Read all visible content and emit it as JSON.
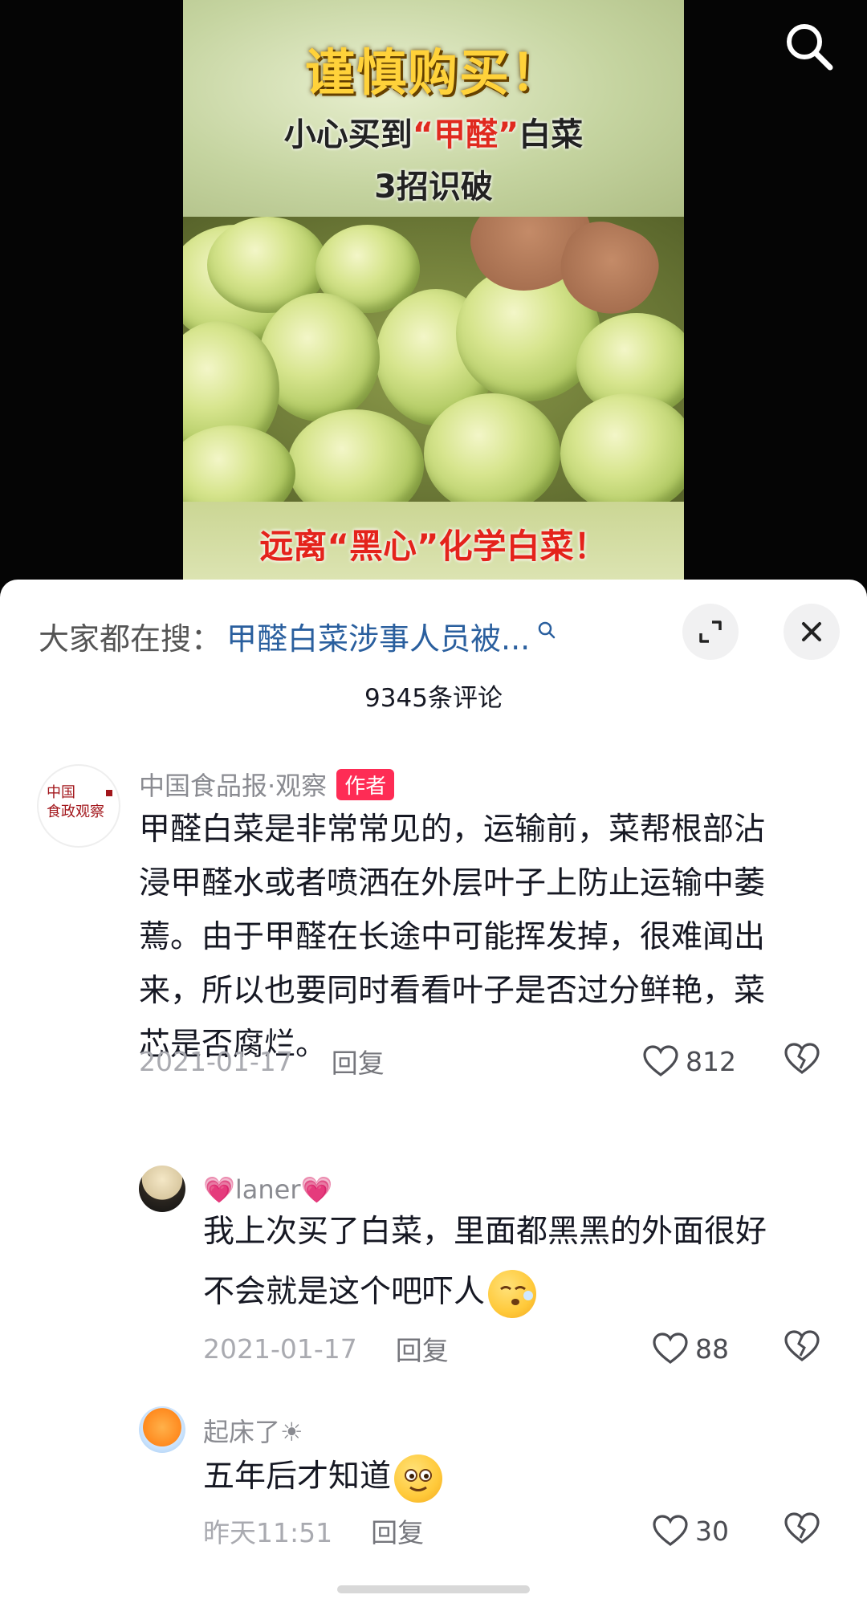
{
  "video": {
    "title_main": "谨慎购买！",
    "title_sub_prefix": "小心买到",
    "title_sub_highlight": "“甲醛”",
    "title_sub_suffix": "白菜",
    "title_sub2": "3招识破",
    "title_bottom": "远离“黑心”化学白菜！"
  },
  "sheet": {
    "hot_search_label": "大家都在搜：",
    "hot_search_link": "甲醛白菜涉事人员被...",
    "comment_count": "9345条评论"
  },
  "comments": [
    {
      "username": "中国食品报·观察",
      "badge": "作者",
      "avatar_text_line1": "中国",
      "avatar_text_line2": "食政观察",
      "text_lines": [
        "甲醛白菜是非常常见的，运输前，菜帮根部沾",
        "浸甲醛水或者喷洒在外层叶子上防止运输中萎",
        "蔫。由于甲醛在长途中可能挥发掉，很难闻出",
        "来，所以也要同时看看叶子是否过分鲜艳，菜",
        "芯是否腐烂。"
      ],
      "date": "2021-01-17",
      "reply_label": "回复",
      "likes": "812"
    },
    {
      "username": "💗laner💗",
      "text_lines": [
        "我上次买了白菜，里面都黑黑的外面很好",
        "不会就是这个吧吓人"
      ],
      "date": "2021-01-17",
      "reply_label": "回复",
      "likes": "88"
    },
    {
      "username": "起床了☀",
      "text_lines": [
        "五年后才知道"
      ],
      "date": "昨天11:51",
      "reply_label": "回复",
      "likes": "30"
    }
  ],
  "colors": {
    "accent": "#fe2c55",
    "link": "#2a5f9e",
    "video_title": "#ffd23a",
    "video_red": "#e02a1f"
  }
}
